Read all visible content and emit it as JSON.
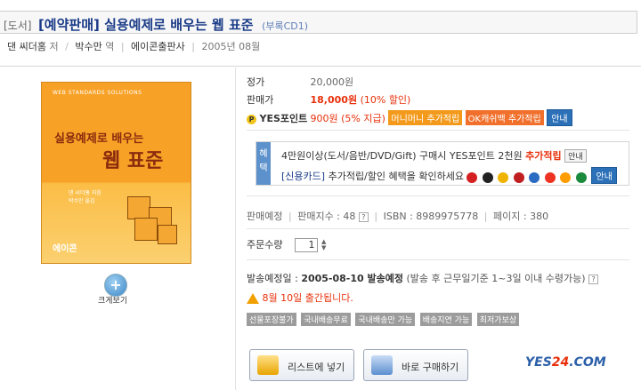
{
  "header": {
    "category": "[도서]",
    "title": "[예약판매] 실용예제로 배우는 웹 표준",
    "subtitle": "(부록CD1)",
    "author": "댄 씨더홈",
    "author_role": "저",
    "translator": "박수만",
    "translator_role": "역",
    "publisher": "에이콘출판사",
    "pub_date": "2005년 08월"
  },
  "cover": {
    "series": "WEB STANDARDS SOLUTIONS",
    "sub_title": "실용예제로 배우는",
    "main_title": "웹 표준",
    "author_line1": "댄 씨더홈 지음",
    "author_line2": "박수만 옮김",
    "publisher_logo": "에이콘"
  },
  "zoom": {
    "label": "크게보기",
    "icon": "plus-icon"
  },
  "price": {
    "list_label": "정가",
    "list_value": "20,000원",
    "sale_label": "판매가",
    "sale_value": "18,000원",
    "sale_rate": "(10% 할인)",
    "point_label": "YES포인트",
    "point_value": "900원 (5% 지급)",
    "badge_money": "머니머니 추가적립",
    "badge_ok": "OK캐쉬백 추가적립",
    "info_btn": "안내"
  },
  "benefit": {
    "tag": "혜택",
    "line1": "4만원이상(도서/음반/DVD/Gift) 구매시 YES포인트 2천원",
    "line1_strong": "추가적립",
    "line1_btn": "안내",
    "card_link": "[신용카드]",
    "line2": "추가적립/할인 혜택을 확인하세요",
    "line2_btn": "안내"
  },
  "sales": {
    "status": "판매예정",
    "index": "판매지수 : 48",
    "isbn": "ISBN : 8989975778",
    "pages": "페이지 : 380"
  },
  "order": {
    "qty_label": "주문수량",
    "qty_value": "1"
  },
  "shipping": {
    "label": "발송예정일 :",
    "date": "2005-08-10 발송예정",
    "note": "(발송 후 근무일기준 1~3일 이내 수령가능)",
    "warning": "8월 10일 출간됩니다."
  },
  "tags": [
    "선물포장불가",
    "국내배송무료",
    "국내배송만 가능",
    "배송지연 가능",
    "최저가보상"
  ],
  "actions": {
    "add_list": "리스트에 넣기",
    "buy_now": "바로 구매하기"
  },
  "brand": {
    "logo_a": "YES",
    "logo_b": "24",
    "logo_c": ".COM"
  },
  "colors": {
    "accent": "#1b3c88",
    "price": "#e8310c",
    "info_button": "#2c70b8"
  }
}
